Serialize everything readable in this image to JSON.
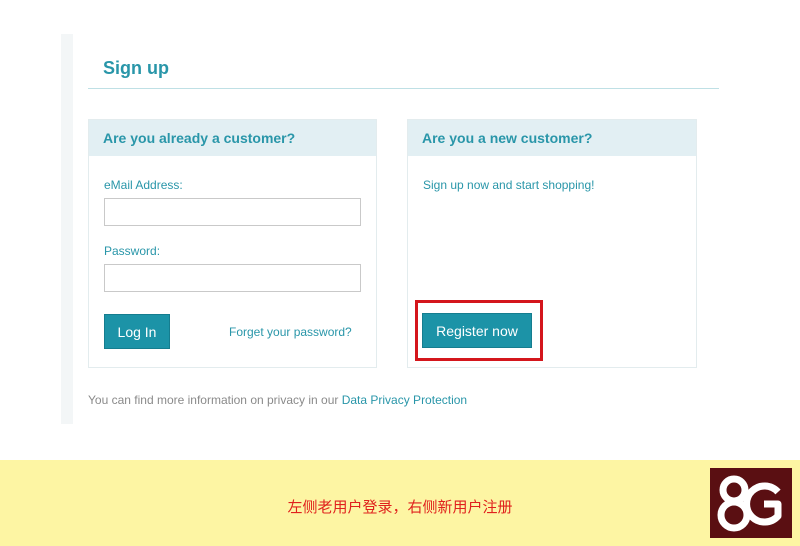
{
  "header": {
    "title": "Sign up"
  },
  "login_panel": {
    "heading": "Are you already a customer?",
    "email_label": "eMail Address:",
    "email_value": "",
    "password_label": "Password:",
    "password_value": "",
    "login_button": "Log In",
    "forgot_link": "Forget your password?"
  },
  "register_panel": {
    "heading": "Are you a new customer?",
    "intro": "Sign up now and start shopping!",
    "register_button": "Register now"
  },
  "privacy": {
    "text": "You can find more information on privacy in our ",
    "link": "Data Privacy Protection"
  },
  "caption": {
    "text": "左侧老用户登录，右侧新用户注册",
    "logo_text": "8G"
  },
  "colors": {
    "accent": "#2996a9",
    "button": "#1c93a7",
    "highlight": "#d4161c",
    "caption_bg": "#fdf5a3",
    "caption_text": "#e0211d",
    "logo_bg": "#5a0f12"
  }
}
